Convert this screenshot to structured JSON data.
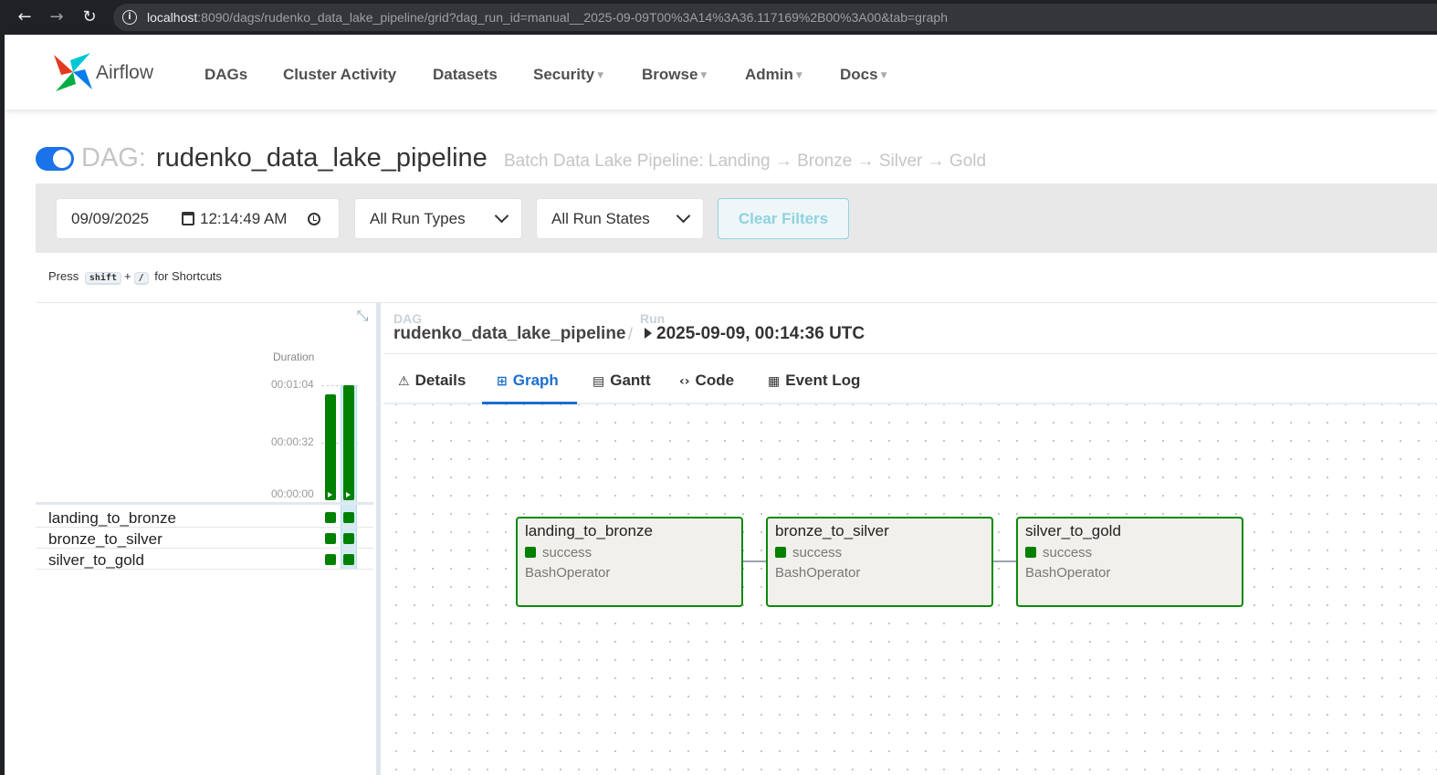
{
  "browser": {
    "url_host": "localhost",
    "url_rest": ":8090/dags/rudenko_data_lake_pipeline/grid?dag_run_id=manual__2025-09-09T00%3A14%3A36.117169%2B00%3A00&tab=graph"
  },
  "navbar": {
    "brand": "Airflow",
    "items": [
      "DAGs",
      "Cluster Activity",
      "Datasets",
      "Security",
      "Browse",
      "Admin",
      "Docs"
    ]
  },
  "dag": {
    "prefix": "DAG:",
    "name": "rudenko_data_lake_pipeline",
    "description": "Batch Data Lake Pipeline: Landing → Bronze → Silver → Gold",
    "active": true
  },
  "filters": {
    "date": "09/09/2025",
    "time": "12:14:49 AM",
    "run_types": "All Run Types",
    "run_states": "All Run States",
    "clear_label": "Clear Filters"
  },
  "shortcuts": {
    "press": "Press",
    "key1": "shift",
    "plus": "+",
    "key2": "/",
    "suffix": "for Shortcuts"
  },
  "grid": {
    "duration_label": "Duration",
    "ticks": [
      "00:01:04",
      "00:00:32",
      "00:00:00"
    ],
    "runs": [
      {
        "duration_fraction": 0.92,
        "state": "success"
      },
      {
        "duration_fraction": 1.0,
        "state": "success"
      }
    ],
    "tasks": [
      {
        "name": "landing_to_bronze",
        "states": [
          "success",
          "success"
        ]
      },
      {
        "name": "bronze_to_silver",
        "states": [
          "success",
          "success"
        ]
      },
      {
        "name": "silver_to_gold",
        "states": [
          "success",
          "success"
        ]
      }
    ]
  },
  "breadcrumb": {
    "dag_label": "DAG",
    "dag_value": "rudenko_data_lake_pipeline",
    "separator": "/",
    "run_label": "Run",
    "run_value": "2025-09-09, 00:14:36 UTC"
  },
  "tabs": [
    {
      "label": "Details",
      "icon": "warning-triangle-icon",
      "active": false
    },
    {
      "label": "Graph",
      "icon": "graph-icon",
      "active": true
    },
    {
      "label": "Gantt",
      "icon": "gantt-icon",
      "active": false
    },
    {
      "label": "Code",
      "icon": "code-icon",
      "active": false
    },
    {
      "label": "Event Log",
      "icon": "calendar-icon",
      "active": false
    }
  ],
  "graph": {
    "nodes": [
      {
        "name": "landing_to_bronze",
        "state": "success",
        "operator": "BashOperator"
      },
      {
        "name": "bronze_to_silver",
        "state": "success",
        "operator": "BashOperator"
      },
      {
        "name": "silver_to_gold",
        "state": "success",
        "operator": "BashOperator"
      }
    ]
  },
  "colors": {
    "success": "#008000",
    "accent": "#1a6fd0",
    "toggle": "#1a73e8"
  }
}
